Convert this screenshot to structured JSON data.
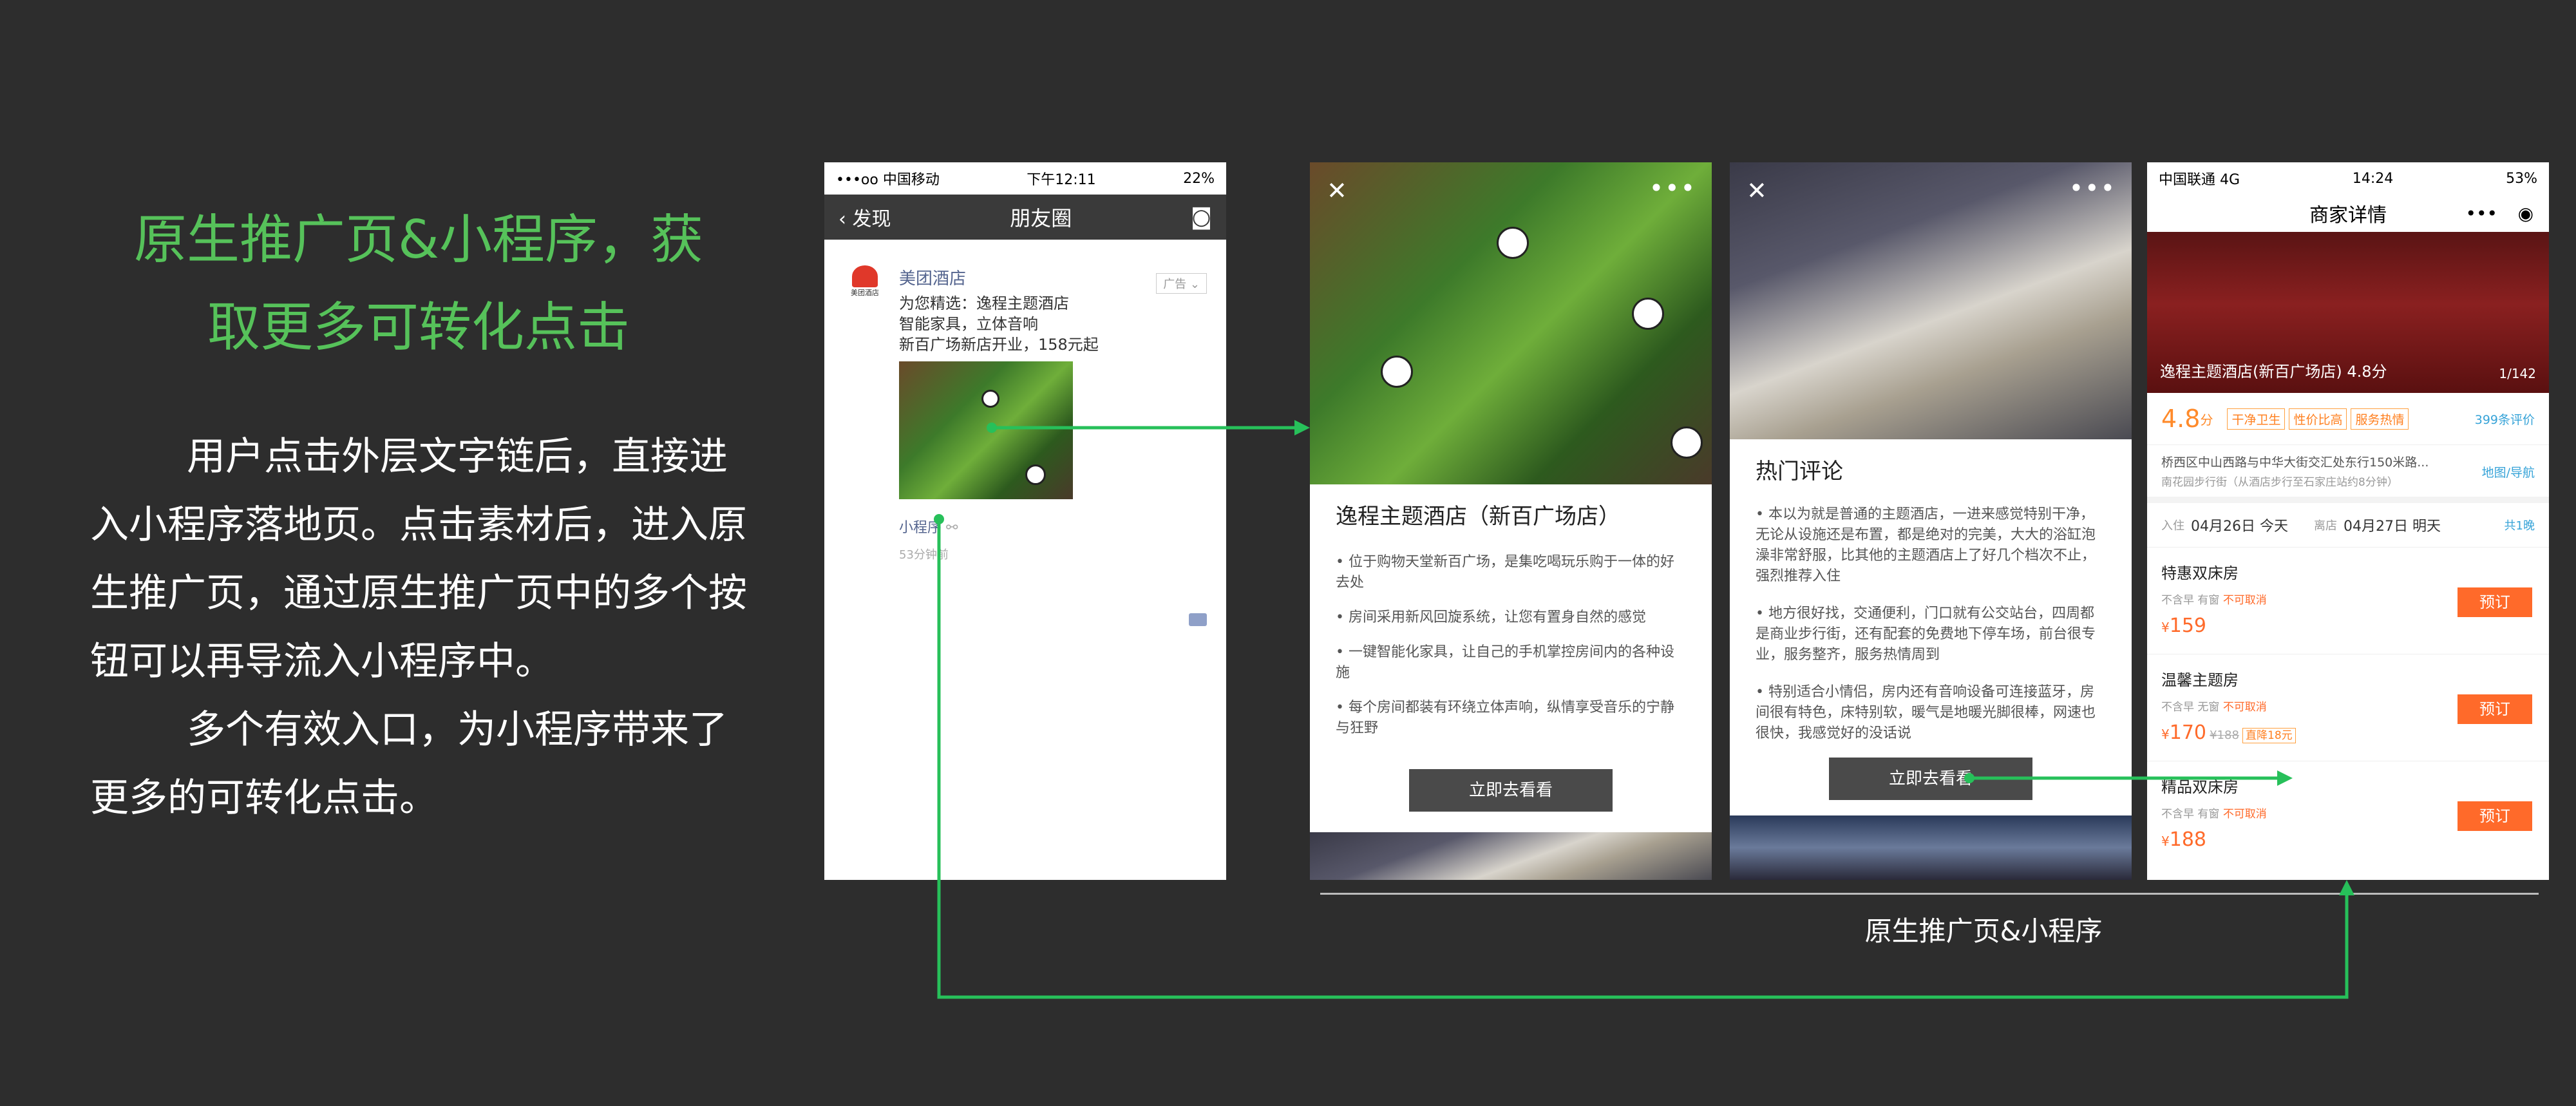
{
  "left": {
    "title_line1": "原生推广页&小程序，获",
    "title_line2": "取更多可转化点击",
    "para1_line1": "用户点击外层文字链后，直接进",
    "para1_line2": "入小程序落地页。点击素材后，进入原",
    "para1_line3": "生推广页，通过原生推广页中的多个按",
    "para1_line4": "钮可以再导流入小程序中。",
    "para2_line1": "多个有效入口，为小程序带来了",
    "para2_line2": "更多的可转化点击。"
  },
  "moments": {
    "status_carrier": "•••oo 中国移动",
    "status_time": "下午12:11",
    "status_battery": "22%",
    "back": "发现",
    "title": "朋友圈",
    "brand_name": "美团酒店",
    "avatar_text": "美团酒店",
    "ad_tag": "广告",
    "text_line1": "为您精选：逸程主题酒店",
    "text_line2": "智能家具，立体音响",
    "text_line3": "新百广场新店开业，158元起",
    "mini_link": "小程序",
    "time_ago": "53分钟前"
  },
  "promo": {
    "hotel_title": "逸程主题酒店（新百广场店）",
    "bullets": [
      "• 位于购物天堂新百广场，是集吃喝玩乐购于一体的好去处",
      "• 房间采用新风回旋系统，让您有置身自然的感觉",
      "• 一键智能化家具，让自己的手机掌控房间内的各种设施",
      "• 每个房间都装有环绕立体声响，纵情享受音乐的宁静与狂野"
    ],
    "cta": "立即去看看"
  },
  "reviews": {
    "heading": "热门评论",
    "items": [
      "• 本以为就是普通的主题酒店，一进来感觉特别干净，无论从设施还是布置，都是绝对的完美，大大的浴缸泡澡非常舒服，比其他的主题酒店上了好几个档次不止，强烈推荐入住",
      "• 地方很好找，交通便利，门口就有公交站台，四周都是商业步行街，还有配套的免费地下停车场，前台很专业，服务整齐，服务热情周到",
      "• 特别适合小情侣，房内还有音响设备可连接蓝牙，房间很有特色，床特别软，暖气是地暖光脚很棒，网速也很快，我感觉好的没话说"
    ],
    "cta": "立即去看看"
  },
  "detail": {
    "status_carrier": "中国联通 4G",
    "status_time": "14:24",
    "status_battery": "53%",
    "title": "商家详情",
    "photo_caption": "逸程主题酒店(新百广场店)",
    "photo_score": "4.8分",
    "photo_index": "1/142",
    "score": "4.8",
    "score_unit": "分",
    "tags": [
      "干净卫生",
      "性价比高",
      "服务热情"
    ],
    "review_count": "399条评价",
    "address": "桥西区中山西路与中华大街交汇处东行150米路...",
    "address_sub": "南花园步行街（从酒店步行至石家庄站约8分钟）",
    "nav_link": "地图/导航",
    "checkin_label": "入住",
    "checkin_date": "04月26日 今天",
    "checkout_label": "离店",
    "checkout_date": "04月27日 明天",
    "nights": "共1晚",
    "rooms": [
      {
        "name": "特惠双床房",
        "meal": "不含早",
        "window": "有窗",
        "cancel": "不可取消",
        "price": "159",
        "original": "",
        "promo": ""
      },
      {
        "name": "温馨主题房",
        "meal": "不含早",
        "window": "无窗",
        "cancel": "不可取消",
        "price": "170",
        "original": "¥188",
        "promo": "直降18元"
      },
      {
        "name": "精品双床房",
        "meal": "不含早",
        "window": "有窗",
        "cancel": "不可取消",
        "price": "188",
        "original": "",
        "promo": ""
      }
    ],
    "book_label": "预订",
    "currency": "¥"
  },
  "caption": "原生推广页&小程序",
  "colors": {
    "accent_green": "#56c25a",
    "arrow_green": "#27c05a",
    "orange": "#ff6a2a",
    "background": "#2d2d2d"
  }
}
